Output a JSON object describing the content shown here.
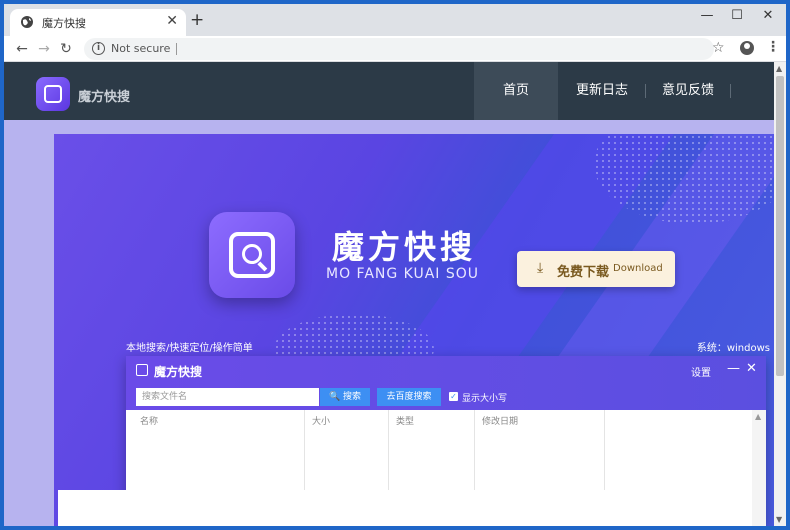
{
  "browser": {
    "tab_title": "魔方快搜",
    "tab_close": "✕",
    "new_tab": "+",
    "win_min": "—",
    "win_max": "☐",
    "win_close": "✕",
    "back": "←",
    "forward": "→",
    "reload": "↻",
    "security_label": "Not secure",
    "star": "☆",
    "menu": "⋮"
  },
  "site": {
    "logo_text": "魔方快搜",
    "nav": [
      "首页",
      "更新日志",
      "意见反馈"
    ]
  },
  "hero": {
    "title": "魔方快搜",
    "subtitle": "MO FANG KUAI SOU",
    "download_cn": "免费下载",
    "download_en": "Download",
    "download_icon": "⤓",
    "features": "本地搜索/快速定位/操作简单",
    "system": "系统：windows"
  },
  "app": {
    "title": "魔方快搜",
    "settings": "设置",
    "minimize": "—",
    "close": "✕",
    "search_placeholder": "搜索文件名",
    "search_button": "🔍 搜索",
    "baidu_button": "去百度搜索",
    "checkbox_mark": "✓",
    "case_label": "显示大小写",
    "columns": [
      "名称",
      "大小",
      "类型",
      "修改日期"
    ],
    "scroll_up": "▲"
  },
  "scrollbar": {
    "up": "▲",
    "down": "▼"
  },
  "colors": {
    "header_bg": "#2c3a47",
    "banner_primary": "#5a45e2",
    "accent_blue": "#3d8ff3",
    "download_bg": "#fbf1de"
  },
  "icons": {
    "tab_favicon": "globe-icon",
    "info": "info-icon",
    "star": "star-icon",
    "account": "account-icon",
    "menu": "menu-icon",
    "logo": "magnifier-logo-icon"
  }
}
